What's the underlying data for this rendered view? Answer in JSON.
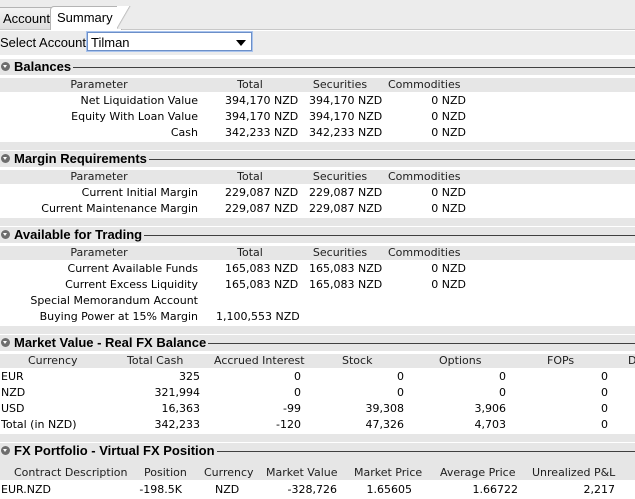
{
  "tabs": {
    "account": "Account",
    "summary": "Summary"
  },
  "account_select": {
    "label": "Select Account",
    "value": "Tilman"
  },
  "cols": {
    "parameter": "Parameter",
    "total": "Total",
    "securities": "Securities",
    "commodities": "Commodities"
  },
  "balances": {
    "title": "Balances",
    "rows": [
      {
        "p": "Net Liquidation Value",
        "t": "394,170 NZD",
        "s": "394,170 NZD",
        "c": "0 NZD"
      },
      {
        "p": "Equity With Loan Value",
        "t": "394,170 NZD",
        "s": "394,170 NZD",
        "c": "0 NZD"
      },
      {
        "p": "Cash",
        "t": "342,233 NZD",
        "s": "342,233 NZD",
        "c": "0 NZD"
      }
    ]
  },
  "margin": {
    "title": "Margin Requirements",
    "rows": [
      {
        "p": "Current Initial Margin",
        "t": "229,087 NZD",
        "s": "229,087 NZD",
        "c": "0 NZD"
      },
      {
        "p": "Current Maintenance Margin",
        "t": "229,087 NZD",
        "s": "229,087 NZD",
        "c": "0 NZD"
      }
    ]
  },
  "available": {
    "title": "Available for Trading",
    "rows": [
      {
        "p": "Current Available Funds",
        "t": "165,083 NZD",
        "s": "165,083 NZD",
        "c": "0 NZD"
      },
      {
        "p": "Current Excess Liquidity",
        "t": "165,083 NZD",
        "s": "165,083 NZD",
        "c": "0 NZD"
      },
      {
        "p": "Special Memorandum Account",
        "t": "",
        "s": "",
        "c": ""
      },
      {
        "p": "Buying Power at 15% Margin",
        "t": "1,100,553 NZD",
        "s": "",
        "c": ""
      }
    ]
  },
  "market": {
    "title": "Market Value - Real FX Balance",
    "cols": {
      "currency": "Currency",
      "cash": "Total Cash",
      "accrued": "Accrued Interest",
      "stock": "Stock",
      "options": "Options",
      "fops": "FOPs",
      "more": "D"
    },
    "rows": [
      {
        "cur": "EUR",
        "cash": "325",
        "acc": "0",
        "stock": "0",
        "opt": "0",
        "fops": "0"
      },
      {
        "cur": "NZD",
        "cash": "321,994",
        "acc": "0",
        "stock": "0",
        "opt": "0",
        "fops": "0"
      },
      {
        "cur": "USD",
        "cash": "16,363",
        "acc": "-99",
        "stock": "39,308",
        "opt": "3,906",
        "fops": "0"
      },
      {
        "cur": "Total (in NZD)",
        "cash": "342,233",
        "acc": "-120",
        "stock": "47,326",
        "opt": "4,703",
        "fops": "0"
      }
    ]
  },
  "fx": {
    "title": "FX Portfolio - Virtual FX Position",
    "cols": {
      "desc": "Contract Description",
      "pos": "Position",
      "cur": "Currency",
      "mv": "Market Value",
      "mp": "Market Price",
      "ap": "Average Price",
      "pnl": "Unrealized P&L"
    },
    "rows": [
      {
        "desc": "EUR.NZD",
        "pos": "-198.5K",
        "cur": "NZD",
        "mv": "-328,726",
        "mp": "1.65605",
        "ap": "1.66722",
        "pnl": "2,217"
      }
    ]
  }
}
